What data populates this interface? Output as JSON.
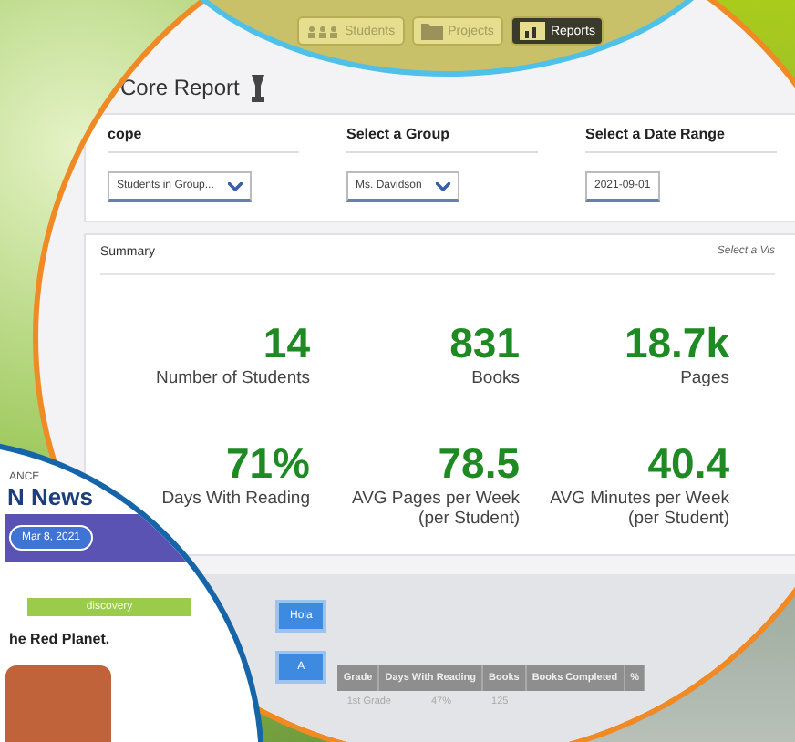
{
  "top_panel": {
    "tabs": [
      {
        "label": "Students",
        "selected": false
      },
      {
        "label": "Projects",
        "selected": false
      },
      {
        "label": "Reports",
        "selected": true
      }
    ]
  },
  "report": {
    "breadcrumb": "Core Report",
    "filters": [
      {
        "label": "cope",
        "value": "Students in Group..."
      },
      {
        "label": "Select a Group",
        "value": "Ms. Davidson"
      },
      {
        "label": "Select a Date Range",
        "value": "2021-09-01",
        "kind": "date"
      }
    ],
    "summary": {
      "title": "Summary",
      "hint": "Select a Vis",
      "stats": [
        {
          "value": "14",
          "label": "Number of Students"
        },
        {
          "value": "831",
          "label": "Books"
        },
        {
          "value": "18.7k",
          "label": "Pages"
        },
        {
          "value": "71%",
          "label": "Days With Reading"
        },
        {
          "value": "78.5",
          "label": "AVG Pages per Week (per Student)"
        },
        {
          "value": "40.4",
          "label": "AVG Minutes per Week (per Student)"
        }
      ]
    },
    "buttons": [
      "Hola",
      "A"
    ],
    "table": {
      "columns": [
        "Grade",
        "Days With Reading",
        "Books",
        "Books Completed",
        "%"
      ],
      "rows": [
        [
          "1st Grade",
          "47%",
          "125"
        ]
      ]
    }
  },
  "news": {
    "brand_small": "ANCE",
    "brand": "N News",
    "date": "Mar 8, 2021",
    "tab": "discovery",
    "headline": "he Red Planet."
  }
}
